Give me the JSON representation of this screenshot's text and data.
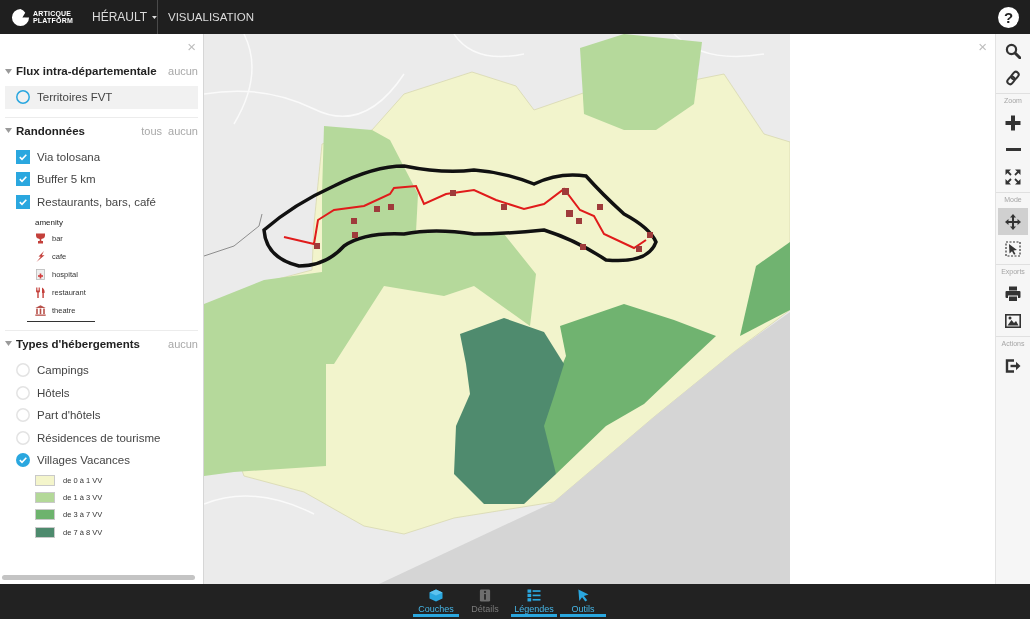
{
  "topbar": {
    "brand": [
      "ARTICQUE",
      "PLATFORM"
    ],
    "menu": "HÉRAULT",
    "title": "VISUALISATION",
    "help": "?"
  },
  "layers_panel": {
    "close": "×",
    "sections": [
      {
        "title": "Flux intra-départementale",
        "expanded": true,
        "actions": [
          "aucun"
        ],
        "items": [
          {
            "kind": "radio",
            "label": "Territoires FVT",
            "checked": false,
            "highlighted": true
          }
        ]
      },
      {
        "title": "Randonnées",
        "expanded": true,
        "actions": [
          "tous",
          "aucun"
        ],
        "items": [
          {
            "kind": "checkbox",
            "label": "Via tolosana",
            "checked": true,
            "highlighted": false
          },
          {
            "kind": "checkbox",
            "label": "Buffer 5 km",
            "checked": true,
            "highlighted": false
          },
          {
            "kind": "checkbox",
            "label": "Restaurants, bars, café",
            "checked": true,
            "highlighted": false,
            "legend": {
              "title": "amenity",
              "entries": [
                {
                  "kind": "cup",
                  "label": "bar"
                },
                {
                  "kind": "bolt",
                  "label": "cafe"
                },
                {
                  "kind": "cross",
                  "label": "hospital"
                },
                {
                  "kind": "cutlery",
                  "label": "restaurant"
                },
                {
                  "kind": "columns",
                  "label": "theatre"
                }
              ]
            }
          }
        ]
      },
      {
        "title": "Types d'hébergements",
        "expanded": true,
        "actions": [
          "aucun"
        ],
        "items": [
          {
            "kind": "radio",
            "label": "Campings",
            "checked": false,
            "highlighted": false
          },
          {
            "kind": "radio",
            "label": "Hôtels",
            "checked": false,
            "highlighted": false
          },
          {
            "kind": "radio",
            "label": "Part d'hôtels",
            "checked": false,
            "highlighted": false
          },
          {
            "kind": "radio",
            "label": "Résidences de tourisme",
            "checked": false,
            "highlighted": false
          },
          {
            "kind": "radio",
            "label": "Villages Vacances",
            "checked": true,
            "highlighted": false,
            "legend": {
              "entries": [
                {
                  "kind": "swatch",
                  "label": "de 0 à 1 VV",
                  "color": "#f4f5cb"
                },
                {
                  "kind": "swatch",
                  "label": "de 1 à 3 VV",
                  "color": "#b3d898"
                },
                {
                  "kind": "swatch",
                  "label": "de 3 à 7 VV",
                  "color": "#6db36d"
                },
                {
                  "kind": "swatch",
                  "label": "de 7 à 8 VV",
                  "color": "#4d8a6d"
                }
              ]
            }
          }
        ]
      }
    ]
  },
  "detail_panel": {
    "close": "×"
  },
  "toolbar": {
    "groups": [
      {
        "buttons": [
          {
            "kind": "search",
            "selected": false
          },
          {
            "kind": "link",
            "selected": false
          }
        ]
      },
      {
        "label": "Zoom",
        "buttons": [
          {
            "kind": "zoom-in",
            "selected": false
          },
          {
            "kind": "zoom-out",
            "selected": false
          },
          {
            "kind": "fit",
            "selected": false
          }
        ]
      },
      {
        "label": "Mode",
        "buttons": [
          {
            "kind": "pan",
            "selected": true
          },
          {
            "kind": "select",
            "selected": false
          }
        ]
      },
      {
        "label": "Exports",
        "buttons": [
          {
            "kind": "print",
            "selected": false
          },
          {
            "kind": "image",
            "selected": false
          }
        ]
      },
      {
        "label": "Actions",
        "buttons": [
          {
            "kind": "exit",
            "selected": false
          }
        ]
      }
    ]
  },
  "bottom_tabs": [
    {
      "kind": "layers",
      "label": "Couches",
      "selected": true,
      "disabled": false
    },
    {
      "kind": "info",
      "label": "Détails",
      "selected": false,
      "disabled": true
    },
    {
      "kind": "list",
      "label": "Légendes",
      "selected": true,
      "disabled": false
    },
    {
      "kind": "pointer",
      "label": "Outils",
      "selected": true,
      "disabled": false
    }
  ]
}
